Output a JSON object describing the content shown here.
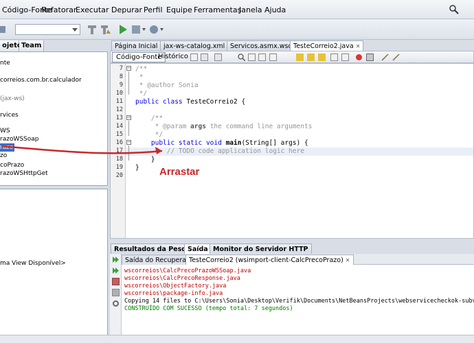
{
  "menu": [
    "Código-Fonte",
    "Refatorar",
    "Executar",
    "Depurar",
    "Perfil",
    "Equipe",
    "Ferramentas",
    "Janela",
    "Ajuda"
  ],
  "left_panel": {
    "tabs": [
      "ojetos",
      "Team"
    ],
    "items": [
      "nte",
      "correios.com.br.calculador",
      "(jax-ws)",
      "rvices",
      "WS",
      "razoWSSoap",
      "razo",
      "zo",
      "coPrazo",
      "razoWSHttpGet"
    ],
    "bottom_text": "ma View Disponível>"
  },
  "editor_tabs": [
    "Página Inicial",
    "jax-ws-catalog.xml",
    "Servicos.asmx.wsdl",
    "TesteCorreio2.java"
  ],
  "editor_toolbar": {
    "source": "Código-Fonte",
    "history": "Histórico"
  },
  "code": {
    "line_numbers": [
      "7",
      "8",
      "9",
      "10",
      "11",
      "12",
      "13",
      "14",
      "15",
      "16",
      "17",
      "18",
      "19",
      "20"
    ],
    "l7": "/**",
    "l8": " *",
    "l9_a": " * ",
    "l9_b": "@author Sonia",
    "l10": " */",
    "l11_kw": "public class ",
    "l11_rest": "TesteCorreio2 {",
    "l13": "    /**",
    "l14_a": "     * @param ",
    "l14_b": "args",
    "l14_c": " the command line arguments",
    "l15": "     */",
    "l16_kw": "    public static void ",
    "l16_b": "main",
    "l16_c": "(String[] args) {",
    "l17": "        // TODO code application logic here",
    "l18": "    }",
    "l19": "}"
  },
  "annotation": "Arrastar",
  "bottom_tabs": [
    "Resultados da Pesquisa",
    "Saída",
    "Monitor do Servidor HTTP"
  ],
  "output_subtabs": [
    "Saída do Recuperador",
    "TesteCorreio2 (wsimport-client-CalcPrecoPrazo)"
  ],
  "output_lines": [
    "wscorreios\\CalcPrecoPrazoWSSoap.java",
    "wscorreios\\CalcPrecoResponse.java",
    "wscorreios\\ObjectFactory.java",
    "wscorreios\\package-info.java",
    "Copying 14 files to C:\\Users\\Sonia\\Desktop\\Verifik\\Documents\\NetBeansProjects\\webservicecheckok-subversion",
    "CONSTRUÍDO COM SUCESSO (tempo total: 7 segundos)"
  ],
  "colors": {
    "annotation": "#c7282b",
    "comment": "#969696",
    "keyword": "#0000e6",
    "output_error": "#c00000",
    "output_success": "#007a00"
  }
}
